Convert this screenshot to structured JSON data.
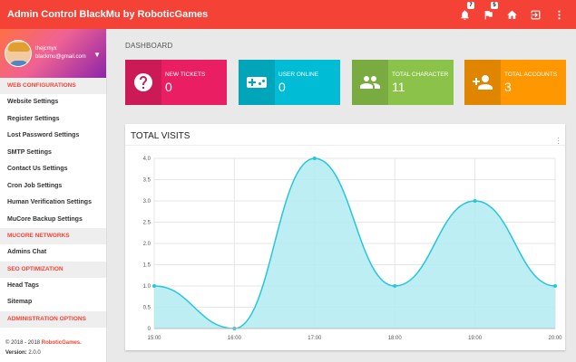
{
  "header": {
    "brand": "Admin Control BlackMu by RoboticGames",
    "notifications_count": "7",
    "flags_count": "5"
  },
  "user": {
    "name": "thejcmyx",
    "email": "blackmu@gmail.com"
  },
  "sidebar": {
    "sections": [
      {
        "title": "WEB CONFIGURATIONS",
        "items": [
          "Website Settings",
          "Register Settings",
          "Lost Password Settings",
          "SMTP Settings",
          "Contact Us Settings",
          "Cron Job Settings",
          "Human Verification Settings",
          "MuCore Backup Settings"
        ]
      },
      {
        "title": "MUCORE NETWORKS",
        "items": [
          "Admins Chat"
        ]
      },
      {
        "title": "SEO OPTIMIZATION",
        "items": [
          "Head Tags",
          "Sitemap"
        ]
      },
      {
        "title": "ADMINISTRATION OPTIONS",
        "items": []
      }
    ],
    "footer_copy": "© 2018 - 2018",
    "footer_company": "RoboticGames.",
    "footer_version_label": "Version:",
    "footer_version": "2.0.0"
  },
  "page": {
    "title": "DASHBOARD"
  },
  "stats": [
    {
      "label": "NEW TICKETS",
      "value": "0",
      "color": "#e91e63",
      "icon": "help-icon"
    },
    {
      "label": "USER ONLINE",
      "value": "0",
      "color": "#00bcd4",
      "icon": "gamepad-icon"
    },
    {
      "label": "TOTAL CHARACTER",
      "value": "11",
      "color": "#8bc34a",
      "icon": "group-icon"
    },
    {
      "label": "TOTAL ACCOUNTS",
      "value": "3",
      "color": "#ff9800",
      "icon": "person-add-icon"
    }
  ],
  "chart_title": "TOTAL VISITS",
  "chart_data": {
    "type": "area",
    "title": "TOTAL VISITS",
    "x": [
      "15:00",
      "16:00",
      "17:00",
      "18:00",
      "19:00",
      "20:00"
    ],
    "values": [
      1.0,
      0.0,
      4.0,
      1.0,
      3.0,
      1.0
    ],
    "ylim": [
      0,
      4
    ],
    "yticks": [
      "0",
      "0.5",
      "1.0",
      "1.5",
      "2.0",
      "2.5",
      "3.0",
      "3.5",
      "4.0"
    ],
    "grid": true,
    "colors": {
      "line": "#26c6da",
      "fill": "#b2ebf2"
    }
  }
}
